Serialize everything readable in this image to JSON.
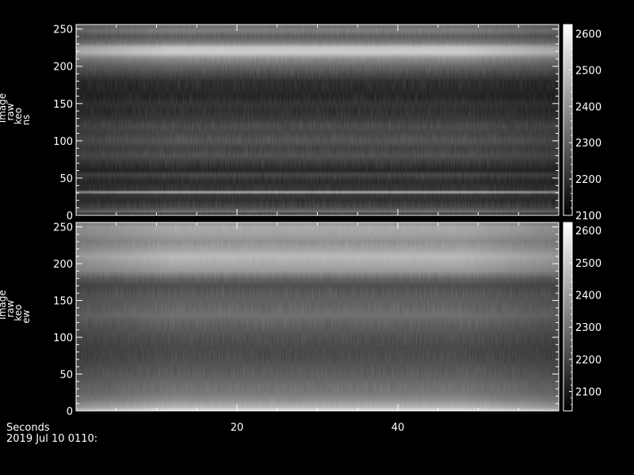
{
  "chart_data": [
    {
      "type": "heatmap",
      "panel": "ns",
      "ylabel_lines": [
        "Image",
        "raw",
        "keo",
        "ns"
      ],
      "ylim": [
        0,
        256
      ],
      "yticks": [
        0,
        50,
        100,
        150,
        200,
        250
      ],
      "xlim": [
        0,
        60
      ],
      "colorbar": {
        "min": 2100,
        "max": 2625,
        "ticks": [
          2100,
          2200,
          2300,
          2400,
          2500,
          2600
        ]
      },
      "profile": [
        {
          "y": 0,
          "v": 2150
        },
        {
          "y": 5,
          "v": 2320
        },
        {
          "y": 10,
          "v": 2240
        },
        {
          "y": 20,
          "v": 2180
        },
        {
          "y": 28,
          "v": 2200
        },
        {
          "y": 31,
          "v": 2450
        },
        {
          "y": 34,
          "v": 2200
        },
        {
          "y": 45,
          "v": 2170
        },
        {
          "y": 55,
          "v": 2230
        },
        {
          "y": 60,
          "v": 2160
        },
        {
          "y": 70,
          "v": 2200
        },
        {
          "y": 80,
          "v": 2250
        },
        {
          "y": 90,
          "v": 2220
        },
        {
          "y": 100,
          "v": 2260
        },
        {
          "y": 110,
          "v": 2230
        },
        {
          "y": 120,
          "v": 2240
        },
        {
          "y": 130,
          "v": 2200
        },
        {
          "y": 140,
          "v": 2180
        },
        {
          "y": 150,
          "v": 2190
        },
        {
          "y": 160,
          "v": 2160
        },
        {
          "y": 170,
          "v": 2170
        },
        {
          "y": 180,
          "v": 2180
        },
        {
          "y": 190,
          "v": 2240
        },
        {
          "y": 200,
          "v": 2300
        },
        {
          "y": 210,
          "v": 2380
        },
        {
          "y": 218,
          "v": 2520
        },
        {
          "y": 225,
          "v": 2500
        },
        {
          "y": 232,
          "v": 2340
        },
        {
          "y": 240,
          "v": 2280
        },
        {
          "y": 248,
          "v": 2350
        },
        {
          "y": 256,
          "v": 2300
        }
      ]
    },
    {
      "type": "heatmap",
      "panel": "ew",
      "ylabel_lines": [
        "Image",
        "raw",
        "keo",
        "ew"
      ],
      "ylim": [
        0,
        256
      ],
      "yticks": [
        0,
        50,
        100,
        150,
        200,
        250
      ],
      "xlim": [
        0,
        60
      ],
      "xticks": [
        20,
        40
      ],
      "xlabel": "Seconds",
      "colorbar": {
        "min": 2040,
        "max": 2625,
        "ticks": [
          2100,
          2200,
          2300,
          2400,
          2500,
          2600
        ]
      },
      "profile": [
        {
          "y": 0,
          "v": 2580
        },
        {
          "y": 5,
          "v": 2450
        },
        {
          "y": 15,
          "v": 2350
        },
        {
          "y": 25,
          "v": 2300
        },
        {
          "y": 35,
          "v": 2280
        },
        {
          "y": 45,
          "v": 2250
        },
        {
          "y": 55,
          "v": 2230
        },
        {
          "y": 70,
          "v": 2200
        },
        {
          "y": 85,
          "v": 2190
        },
        {
          "y": 100,
          "v": 2210
        },
        {
          "y": 115,
          "v": 2240
        },
        {
          "y": 130,
          "v": 2280
        },
        {
          "y": 145,
          "v": 2250
        },
        {
          "y": 160,
          "v": 2230
        },
        {
          "y": 170,
          "v": 2200
        },
        {
          "y": 180,
          "v": 2260
        },
        {
          "y": 190,
          "v": 2380
        },
        {
          "y": 200,
          "v": 2420
        },
        {
          "y": 210,
          "v": 2460
        },
        {
          "y": 220,
          "v": 2400
        },
        {
          "y": 230,
          "v": 2360
        },
        {
          "y": 240,
          "v": 2400
        },
        {
          "y": 250,
          "v": 2420
        },
        {
          "y": 256,
          "v": 2350
        }
      ]
    }
  ],
  "footer": {
    "date_text": "2019 Jul 10 0110:"
  }
}
